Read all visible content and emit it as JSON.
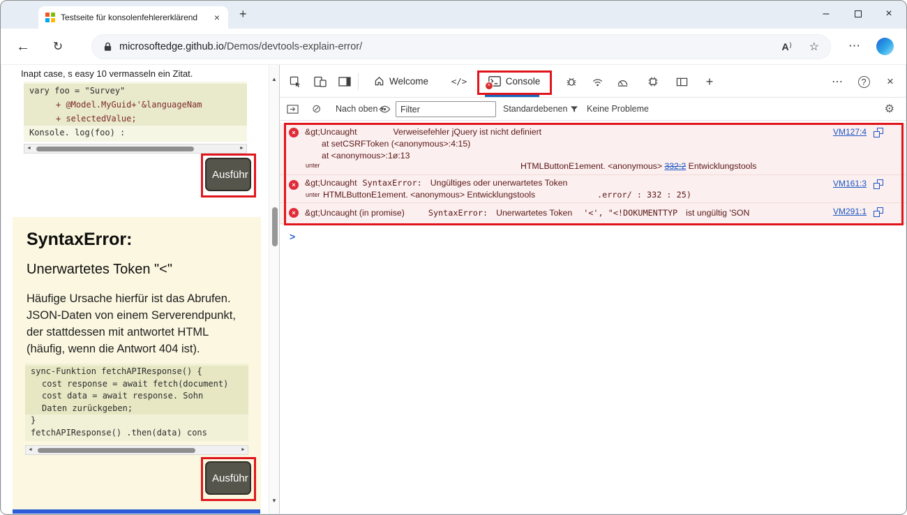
{
  "browser": {
    "tab_title": "Testseite für konsolenfehlererklärend",
    "url_domain": "microsoftedge.github.io",
    "url_path": "/Demos/devtools-explain-error/"
  },
  "icons": {
    "back": "←",
    "refresh": "↻",
    "read_aloud": "A",
    "star": "☆",
    "more": "⋯",
    "minimize": "–",
    "close": "×",
    "new_tab": "+",
    "add": "+",
    "help": "?",
    "sources": "</>",
    "clear_console": "⊘",
    "gear": "⚙",
    "dropdown": "▾",
    "scroll_left": "◄",
    "scroll_right": "►",
    "scroll_up": "▲",
    "scroll_down": "▼",
    "prompt": ">",
    "error_x": "×"
  },
  "page": {
    "intro": "Inapt case, s easy 10 vermasseln ein Zitat.",
    "code1": [
      "vary foo = \"Survey\"",
      "+ @Model.MyGuid+'&languageNam",
      "+ selectedValue;",
      "Konsole. log(foo) :"
    ],
    "run_label": "Ausführ",
    "error_card": {
      "title": "SyntaxError:",
      "subtitle": "Unerwartetes Token \"<\"",
      "body": "Häufige Ursache hierfür ist das Abrufen. JSON-Daten von einem Serverendpunkt, der stattdessen mit antwortet HTML (häufig, wenn die Antwort 404 ist).",
      "code2": [
        "sync-Funktion fetchAPIResponse() {",
        "cost response = await fetch(document)",
        "cost data = await response. Sohn",
        "Daten zurückgeben;",
        "}",
        "fetchAPIResponse() .then(data) cons"
      ],
      "run_label": "Ausführ"
    }
  },
  "devtools": {
    "tabs": {
      "welcome": "Welcome",
      "console": "Console"
    },
    "toolbar": {
      "context": "Nach oben",
      "filter": "Filter",
      "levels": "Standardebenen",
      "issues": "Keine Probleme"
    },
    "messages": [
      {
        "prefix": "&gt;Uncaught",
        "main": "Verweisefehler jQuery ist nicht definiert",
        "stack1": "at setCSRFToken (<anonymous>:4:15)",
        "stack2": "at <anonymous>:1ø:13",
        "unter": "unter",
        "frame": "HTMLButtonE1ement. <anonymous>",
        "frame_link": "332:2",
        "frame_tail": "Entwicklungstools",
        "source": "VM127:4"
      },
      {
        "prefix": "&gt;Uncaught",
        "type": "SyntaxError:",
        "main": "Ungültiges oder unerwartetes Token",
        "unter": "unter",
        "frame": "HTMLButtonE1ement. <anonymous> Entwicklungstools",
        "frame_tail": ".error/ : 332 : 25)",
        "source": "VM161:3"
      },
      {
        "prefix": "&gt;Uncaught (in promise)",
        "type": "SyntaxError:",
        "main": "Unerwartetes Token",
        "token": "'<', \"<!DOKUMENTTYP",
        "tail": "ist ungültig 'SON",
        "source": "VM291:1"
      }
    ]
  }
}
